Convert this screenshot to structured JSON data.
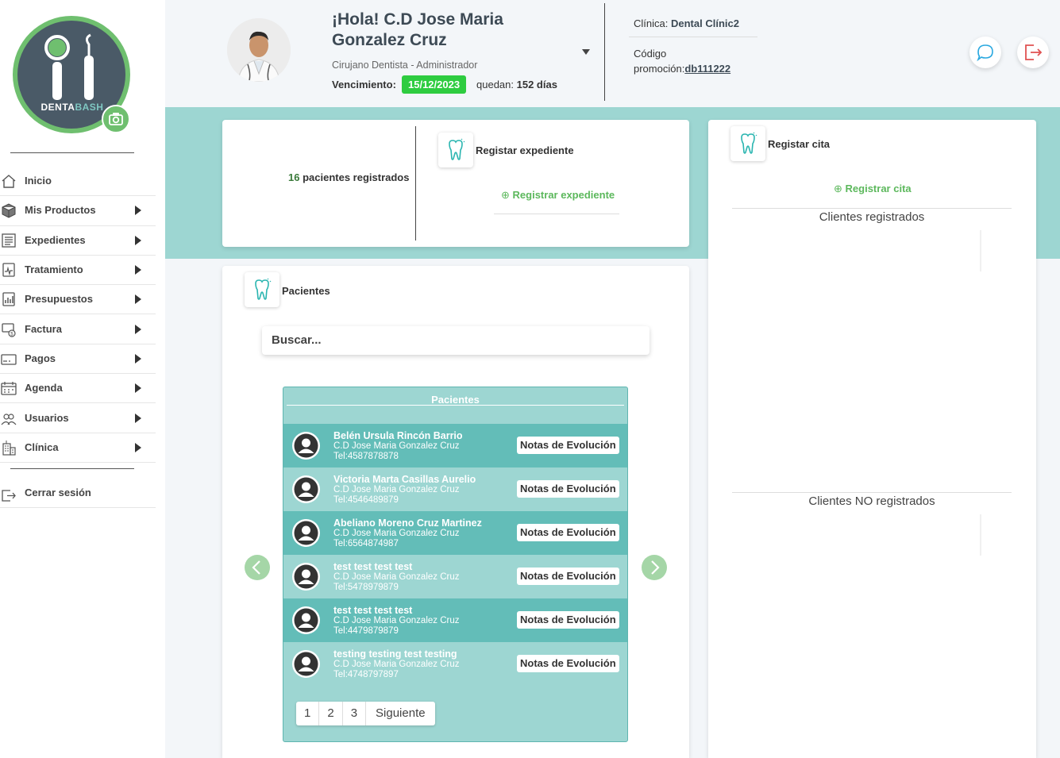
{
  "brand": {
    "name_part1": "DENTA",
    "name_part2": "BASH"
  },
  "sidebar": {
    "items": [
      {
        "label": "Inicio",
        "icon": "home-icon",
        "has_arrow": false
      },
      {
        "label": "Mis Productos",
        "icon": "box-icon",
        "has_arrow": true
      },
      {
        "label": "Expedientes",
        "icon": "file-list-icon",
        "has_arrow": true
      },
      {
        "label": "Tratamiento",
        "icon": "treatment-icon",
        "has_arrow": true
      },
      {
        "label": "Presupuestos",
        "icon": "budget-icon",
        "has_arrow": true
      },
      {
        "label": "Factura",
        "icon": "invoice-icon",
        "has_arrow": true
      },
      {
        "label": "Pagos",
        "icon": "payment-card-icon",
        "has_arrow": true
      },
      {
        "label": "Agenda",
        "icon": "calendar-icon",
        "has_arrow": true
      },
      {
        "label": "Usuarios",
        "icon": "users-icon",
        "has_arrow": true
      },
      {
        "label": "Clínica",
        "icon": "building-icon",
        "has_arrow": true
      }
    ],
    "logout_label": "Cerrar sesión"
  },
  "header": {
    "greeting": "¡Hola! C.D Jose Maria Gonzalez Cruz",
    "role": "Cirujano Dentista - Administrador",
    "expiry_label": "Vencimiento:",
    "expiry_date": "15/12/2023",
    "remaining_label": "quedan:",
    "remaining_value": "152 días",
    "clinic_label": "Clínica:",
    "clinic_name": "Dental Clínic2",
    "promo_label": "Código promoción:",
    "promo_code": "db111222"
  },
  "records_card": {
    "count_number": "16",
    "count_text": "pacientes registrados",
    "title": "Registar expediente",
    "action": "Registrar expediente"
  },
  "appointments_card": {
    "title": "Registar cita",
    "action": "Registrar cita",
    "registered_heading": "Clientes registrados",
    "unregistered_heading": "Clientes NO registrados"
  },
  "patients_card": {
    "title": "Pacientes",
    "search_placeholder": "Buscar...",
    "table_header": "Pacientes",
    "notes_label": "Notas de Evolución",
    "rows": [
      {
        "name": "Belén Ursula Rincón Barrio",
        "doctor": "C.D Jose Maria Gonzalez Cruz",
        "tel": "Tel:4587878878"
      },
      {
        "name": "Victoria Marta Casillas Aurelio",
        "doctor": "C.D Jose Maria Gonzalez Cruz",
        "tel": "Tel:4546489879"
      },
      {
        "name": "Abeliano Moreno Cruz Martinez",
        "doctor": "C.D Jose Maria Gonzalez Cruz",
        "tel": "Tel:6564874987"
      },
      {
        "name": "test test test test",
        "doctor": "C.D Jose Maria Gonzalez Cruz",
        "tel": "Tel:5478979879"
      },
      {
        "name": "test test test test",
        "doctor": "C.D Jose Maria Gonzalez Cruz",
        "tel": "Tel:4479879879"
      },
      {
        "name": "testing testing test testing",
        "doctor": "C.D Jose Maria Gonzalez Cruz",
        "tel": "Tel:4748797897"
      }
    ],
    "pagination": [
      "1",
      "2",
      "3",
      "Siguiente"
    ]
  },
  "colors": {
    "teal": "#9dd6d2",
    "teal_dark": "#63bdb8",
    "green": "#5cb85c",
    "badge_green": "#2ecc40",
    "logout_red": "#e05252",
    "chat_blue": "#29a8e0"
  }
}
